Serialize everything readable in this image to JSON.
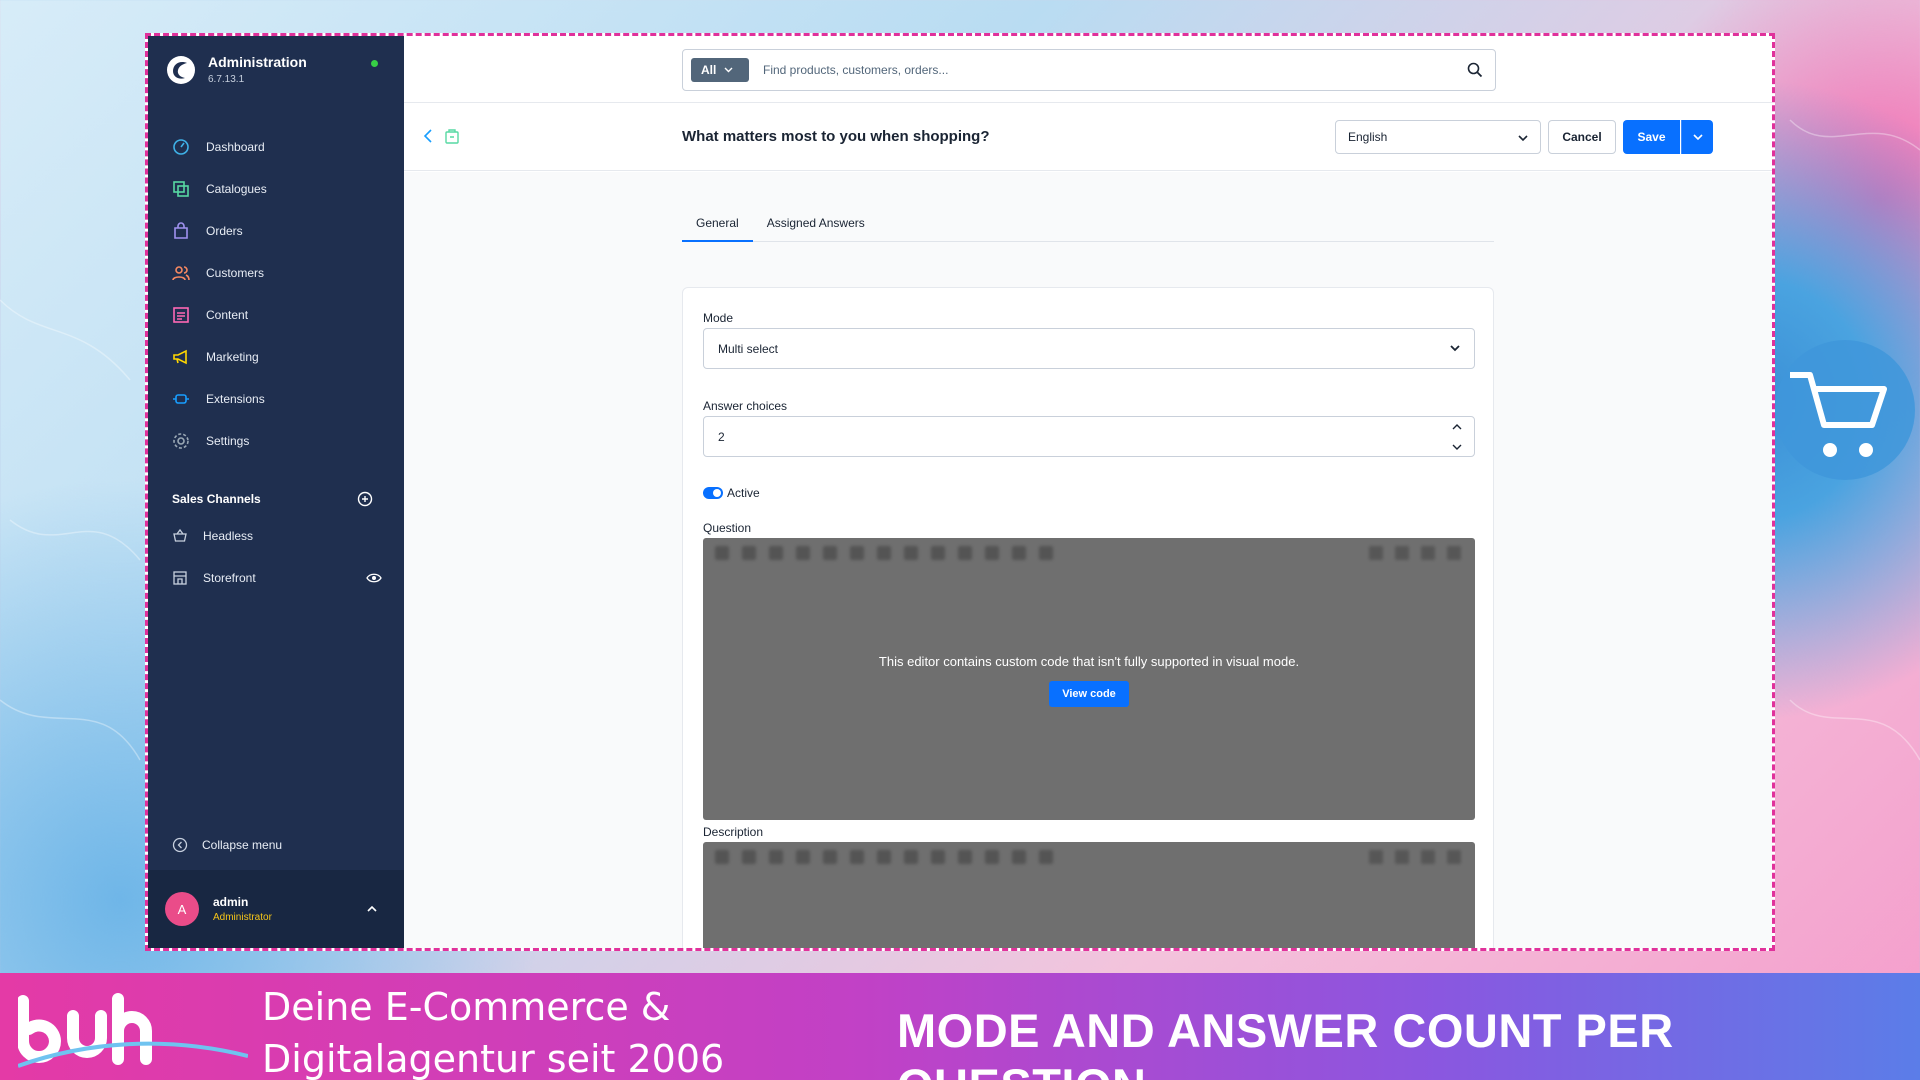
{
  "sidebar": {
    "brand_title": "Administration",
    "brand_version": "6.7.13.1",
    "nav": [
      {
        "label": "Dashboard",
        "icon": "dashboard-icon",
        "color": "#3fb2e8"
      },
      {
        "label": "Catalogues",
        "icon": "catalogues-icon",
        "color": "#57d9a3"
      },
      {
        "label": "Orders",
        "icon": "orders-icon",
        "color": "#a092f0"
      },
      {
        "label": "Customers",
        "icon": "customers-icon",
        "color": "#f88962"
      },
      {
        "label": "Content",
        "icon": "content-icon",
        "color": "#ff68b4"
      },
      {
        "label": "Marketing",
        "icon": "marketing-icon",
        "color": "#ffd700"
      },
      {
        "label": "Extensions",
        "icon": "extensions-icon",
        "color": "#189eff"
      },
      {
        "label": "Settings",
        "icon": "settings-icon",
        "color": "#9aa8b5"
      }
    ],
    "sales_channels_title": "Sales Channels",
    "sales_channels": [
      {
        "label": "Headless"
      },
      {
        "label": "Storefront"
      }
    ],
    "collapse_label": "Collapse menu",
    "user": {
      "initial": "A",
      "name": "admin",
      "role": "Administrator"
    }
  },
  "topbar": {
    "search_type": "All",
    "search_placeholder": "Find products, customers, orders..."
  },
  "actionbar": {
    "title": "What matters most to you when shopping?",
    "language": "English",
    "cancel_label": "Cancel",
    "save_label": "Save"
  },
  "tabs": [
    {
      "label": "General",
      "active": true
    },
    {
      "label": "Assigned Answers",
      "active": false
    }
  ],
  "form": {
    "mode_label": "Mode",
    "mode_value": "Multi select",
    "answer_choices_label": "Answer choices",
    "answer_choices_value": "2",
    "active_label": "Active",
    "question_label": "Question",
    "editor_message": "This editor contains custom code that isn't fully supported in visual mode.",
    "view_code_label": "View code",
    "description_label": "Description"
  },
  "footer": {
    "tagline_line1": "Deine E-Commerce &",
    "tagline_line2": "Digitalagentur seit 2006",
    "headline": "MODE AND ANSWER COUNT PER QUESTION"
  },
  "colors": {
    "accent": "#0870ff",
    "sidebar": "#1f2f4f",
    "frame": "#e0319b"
  }
}
